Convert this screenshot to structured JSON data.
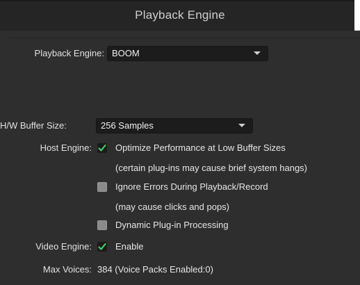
{
  "window": {
    "title": "Playback Engine"
  },
  "playback_engine": {
    "label": "Playback Engine:",
    "value": "BOOM"
  },
  "hw_buffer": {
    "label": "H/W Buffer Size:",
    "value": "256 Samples"
  },
  "host_engine": {
    "label": "Host Engine:",
    "options": [
      {
        "label": "Optimize Performance at Low Buffer Sizes",
        "note": "(certain plug-ins may cause brief system hangs)",
        "checked": true
      },
      {
        "label": "Ignore Errors During Playback/Record",
        "note": "(may cause clicks and pops)",
        "checked": false
      },
      {
        "label": "Dynamic Plug-in Processing",
        "checked": false
      }
    ]
  },
  "video_engine": {
    "label": "Video Engine:",
    "option_label": "Enable",
    "checked": true
  },
  "max_voices": {
    "label": "Max Voices:",
    "value": "384 (Voice Packs Enabled:0)"
  },
  "colors": {
    "checkmark": "#3fd16b",
    "background": "#2e2e2e",
    "titlebar": "#252525",
    "select_bg": "#1c1c1c"
  }
}
